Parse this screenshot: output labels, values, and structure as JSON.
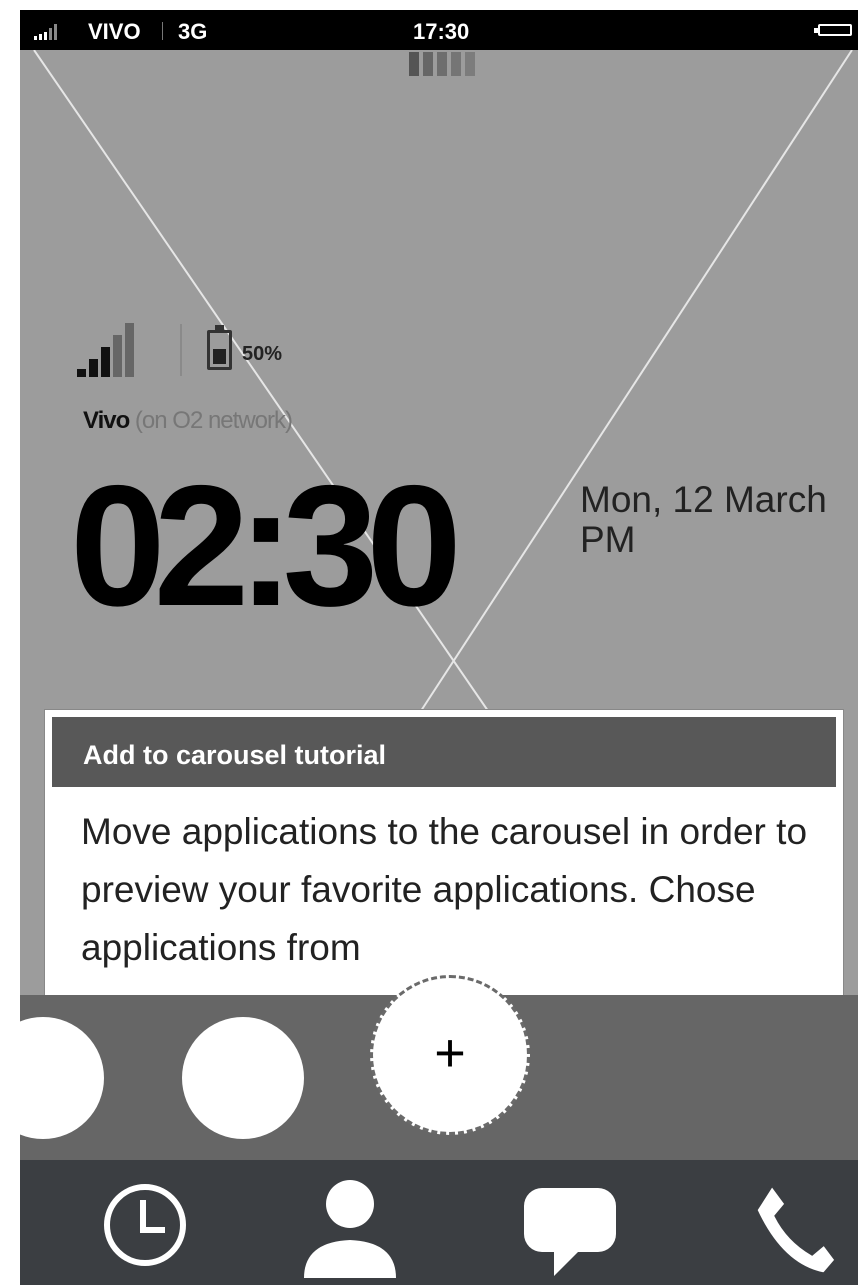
{
  "status_bar": {
    "carrier": "VIVO",
    "network": "3G",
    "time": "17:30",
    "icons": [
      "signal-icon",
      "battery-icon"
    ]
  },
  "lock_screen": {
    "battery_percent": "50%",
    "carrier_name": "Vivo",
    "network_note": "(on O2 network)",
    "time": "02:30",
    "date": "Mon, 12 March",
    "ampm": "PM",
    "icons": [
      "signal-bars-icon",
      "battery-icon"
    ]
  },
  "tutorial": {
    "title": "Add to carousel tutorial",
    "body": "Move applications to the carousel in order to preview your favorite applications. Chose applications from"
  },
  "carousel": {
    "add_symbol": "+",
    "icons": [
      "add-icon"
    ]
  },
  "tab_bar": {
    "icons": [
      "clock-icon",
      "contact-icon",
      "message-icon",
      "phone-icon"
    ]
  },
  "colors": {
    "background": "#9c9c9c",
    "status_bar": "#000000",
    "card_header": "#585858",
    "carousel": "#666666",
    "tab_bar": "#3b3e42"
  }
}
